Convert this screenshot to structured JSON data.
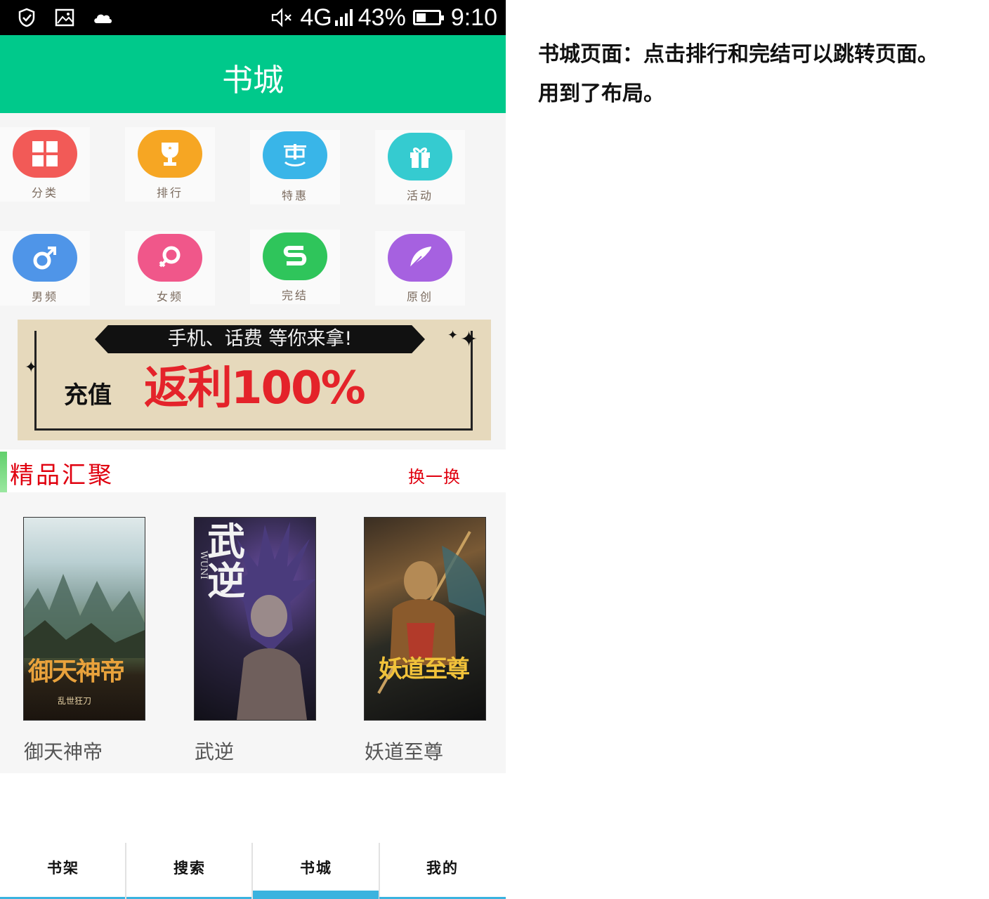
{
  "status_bar": {
    "network": "4G",
    "battery_percent": "43%",
    "battery_level": 0.43,
    "time": "9:10",
    "left_icons": [
      "check-shield-icon",
      "image-icon",
      "cloud-icon"
    ],
    "right_icons": [
      "mute-icon",
      "signal-icon",
      "battery-icon"
    ]
  },
  "header": {
    "title": "书城"
  },
  "categories": [
    {
      "label": "分类",
      "icon": "grid-icon",
      "color": "#f25a57"
    },
    {
      "label": "排行",
      "icon": "trophy-icon",
      "color": "#f6a623"
    },
    {
      "label": "特惠",
      "icon": "discount-icon",
      "color": "#39b5e8"
    },
    {
      "label": "活动",
      "icon": "gift-icon",
      "color": "#35cbd0"
    },
    {
      "label": "男频",
      "icon": "male-icon",
      "color": "#4f95e8"
    },
    {
      "label": "女频",
      "icon": "female-icon",
      "color": "#f0578a"
    },
    {
      "label": "完结",
      "icon": "finished-icon",
      "color": "#2fc55b"
    },
    {
      "label": "原创",
      "icon": "feather-icon",
      "color": "#a661e0"
    }
  ],
  "banner": {
    "ribbon": "手机、话费 等你来拿!",
    "left_text": "充值",
    "big_text": "返利100%"
  },
  "section": {
    "title": "精品汇聚",
    "more": "换一换"
  },
  "books": [
    {
      "name": "御天神帝",
      "cover_title": "御天神帝",
      "cover_sub": "乱世狂刀"
    },
    {
      "name": "武逆",
      "cover_title": "武逆",
      "cover_sub": "WUNI"
    },
    {
      "name": "妖道至尊",
      "cover_title": "妖道至尊",
      "cover_sub": ""
    }
  ],
  "tabs": [
    {
      "label": "书架",
      "active": false
    },
    {
      "label": "搜索",
      "active": false
    },
    {
      "label": "书城",
      "active": true
    },
    {
      "label": "我的",
      "active": false
    }
  ],
  "note": "书城页面：点击排行和完结可以跳转页面。用到了布局。",
  "colors": {
    "accent": "#00c98b",
    "section_red": "#e0000f",
    "tab_indicator": "#3bb3df"
  }
}
